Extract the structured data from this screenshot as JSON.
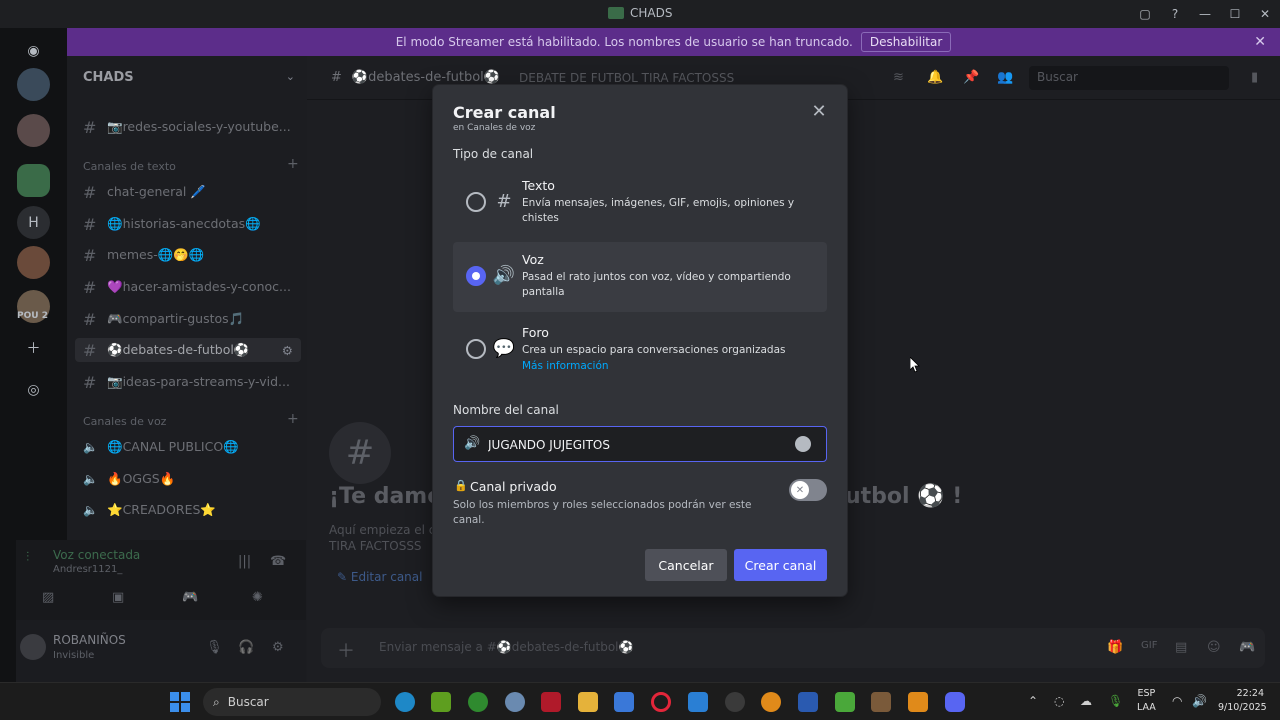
{
  "window": {
    "title": "CHADS"
  },
  "banner": {
    "text": "El modo Streamer está habilitado. Los nombres de usuario se han truncado.",
    "button": "Deshabilitar"
  },
  "rail": {
    "letter_server": "H",
    "pou_label": "POU 2"
  },
  "sidebar": {
    "server_name": "CHADS",
    "top_channel": "📷redes-sociales-y-youtube...",
    "text_category": "Canales de texto",
    "text_channels": [
      "chat-general 🖊️",
      "🌐historias-anecdotas🌐",
      "memes-🌐🤭🌐",
      "💜hacer-amistades-y-conoc...",
      "🎮compartir-gustos🎵",
      "⚽debates-de-futbol⚽",
      "📷ideas-para-streams-y-vid..."
    ],
    "voice_category": "Canales de voz",
    "voice_channels": [
      "🌐CANAL PUBLICO🌐",
      "🔥OGGS🔥",
      "⭐CREADORES⭐"
    ]
  },
  "voice_panel": {
    "status": "Voz conectada",
    "user": "Andresr1121_"
  },
  "user_panel": {
    "name": "ROBANIÑOS",
    "status": "Invisible"
  },
  "chat": {
    "channel_name": "⚽debates-de-futbol⚽",
    "topic": "DEBATE DE FUTBOL TIRA FACTOSSS",
    "search_placeholder": "Buscar",
    "welcome_left": "¡Te damo",
    "welcome_right": "utbol ⚽ !",
    "welcome_sub_1": "Aquí empieza el ca",
    "welcome_sub_2": "TIRA FACTOSSS",
    "edit_channel": "Editar canal",
    "composer_placeholder": "Enviar mensaje a #⚽debates-de-futbol⚽"
  },
  "modal": {
    "title": "Crear canal",
    "subtitle": "en Canales de voz",
    "type_label": "Tipo de canal",
    "options": [
      {
        "name": "Texto",
        "desc": "Envía mensajes, imágenes, GIF, emojis, opiniones y chistes",
        "selected": false
      },
      {
        "name": "Voz",
        "desc": "Pasad el rato juntos con voz, vídeo y compartiendo pantalla",
        "selected": true
      },
      {
        "name": "Foro",
        "desc": "Crea un espacio para conversaciones organizadas",
        "link": "Más información",
        "selected": false
      }
    ],
    "name_label": "Nombre del canal",
    "name_value": "JUGANDO JUJEGITOS",
    "private_title": "Canal privado",
    "private_desc": "Solo los miembros y roles seleccionados podrán ver este canal.",
    "private_enabled": false,
    "cancel_label": "Cancelar",
    "create_label": "Crear canal"
  },
  "taskbar": {
    "search_label": "Buscar",
    "lang_1": "ESP",
    "lang_2": "LAA",
    "time": "22:24",
    "date": "9/10/2025"
  },
  "colors": {
    "accent": "#5865f2",
    "banner": "#5c2d8a",
    "modal_bg": "#313338"
  }
}
